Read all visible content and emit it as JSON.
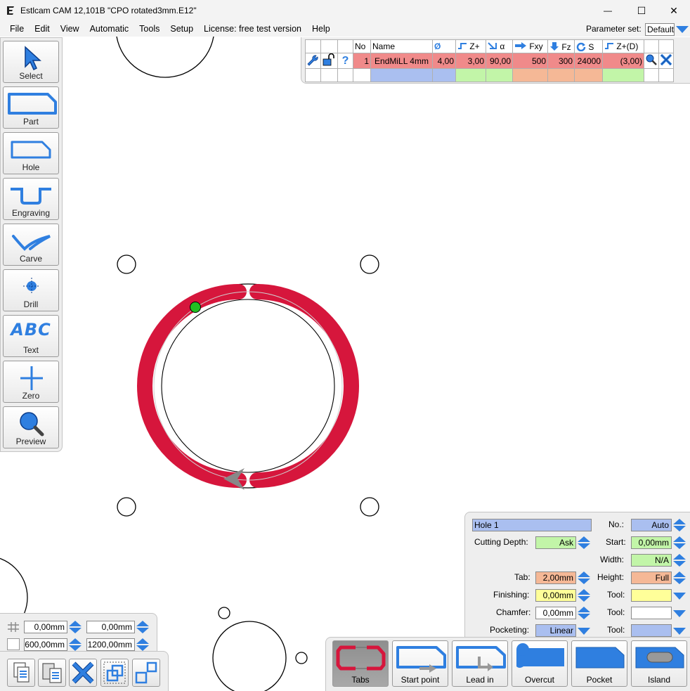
{
  "window": {
    "title": "Estlcam CAM 12,101B \"CPO rotated3mm.E12\"",
    "minimize_glyph": "—",
    "maximize_glyph": "☐",
    "close_glyph": "✕"
  },
  "menu": {
    "items": [
      "File",
      "Edit",
      "View",
      "Automatic",
      "Tools",
      "Setup",
      "License: free test version",
      "Help"
    ],
    "parameter_set_label": "Parameter set:",
    "parameter_set_value": "Default"
  },
  "left_toolbar": {
    "buttons": [
      {
        "label": "Select",
        "icon": "arrow-cursor-icon"
      },
      {
        "label": "Part",
        "icon": "part-outline-icon"
      },
      {
        "label": "Hole",
        "icon": "hole-outline-icon"
      },
      {
        "label": "Engraving",
        "icon": "engraving-icon"
      },
      {
        "label": "Carve",
        "icon": "carve-icon"
      },
      {
        "label": "Drill",
        "icon": "drill-icon"
      },
      {
        "label": "Text",
        "icon": "text-icon"
      },
      {
        "label": "Zero",
        "icon": "zero-crosshair-icon"
      },
      {
        "label": "Preview",
        "icon": "magnifier-icon"
      }
    ],
    "text_icon_glyph": "ABC"
  },
  "tool_table": {
    "headers": {
      "help_glyph": "?",
      "no": "No",
      "name": "Name",
      "diameter_glyph": "Ø",
      "z_plus": "Z+",
      "angle": "α",
      "fxy": "Fxy",
      "fz": "Fz",
      "s": "S",
      "z_plus_d": "Z+(D)"
    },
    "row": {
      "no": "1",
      "name": "EndMiLL 4mm",
      "diameter": "4,00",
      "z_plus": "3,00",
      "angle": "90,00",
      "fxy": "500",
      "fz": "300",
      "s": "24000",
      "z_plus_d": "(3,00)"
    }
  },
  "coords": {
    "x": "0,00mm",
    "y": "0,00mm",
    "width": "600,00mm",
    "height": "1200,00mm"
  },
  "properties": {
    "name_value": "Hole 1",
    "no_label": "No.:",
    "no_value": "Auto",
    "cutting_depth_label": "Cutting Depth:",
    "cutting_depth_value": "Ask",
    "start_label": "Start:",
    "start_value": "0,00mm",
    "width_label": "Width:",
    "width_value": "N/A",
    "tab_label": "Tab:",
    "tab_value": "2,00mm",
    "height_label": "Height:",
    "height_value": "Full",
    "finishing_label": "Finishing:",
    "finishing_value": "0,00mm",
    "tool_label_1": "Tool:",
    "chamfer_label": "Chamfer:",
    "chamfer_value": "0,00mm",
    "tool_label_2": "Tool:",
    "pocketing_label": "Pocketing:",
    "pocketing_value": "Linear",
    "tool_label_3": "Tool:"
  },
  "actions": {
    "buttons": [
      {
        "label": "Tabs",
        "icon": "tabs-icon",
        "active": true
      },
      {
        "label": "Start point",
        "icon": "start-point-icon",
        "active": false
      },
      {
        "label": "Lead in",
        "icon": "lead-in-icon",
        "active": false
      },
      {
        "label": "Overcut",
        "icon": "overcut-icon",
        "active": false
      },
      {
        "label": "Pocket",
        "icon": "pocket-icon",
        "active": false
      },
      {
        "label": "Island",
        "icon": "island-icon",
        "active": false
      }
    ]
  },
  "colors": {
    "accent": "#2f7fe0",
    "toolpath": "#d6163c",
    "green_start": "#22c022",
    "tool_row": "#f08a8a",
    "field_blue": "#aabff0",
    "field_green": "#c2f5a8",
    "field_salmon": "#f5b896",
    "field_yellow": "#ffff99"
  }
}
